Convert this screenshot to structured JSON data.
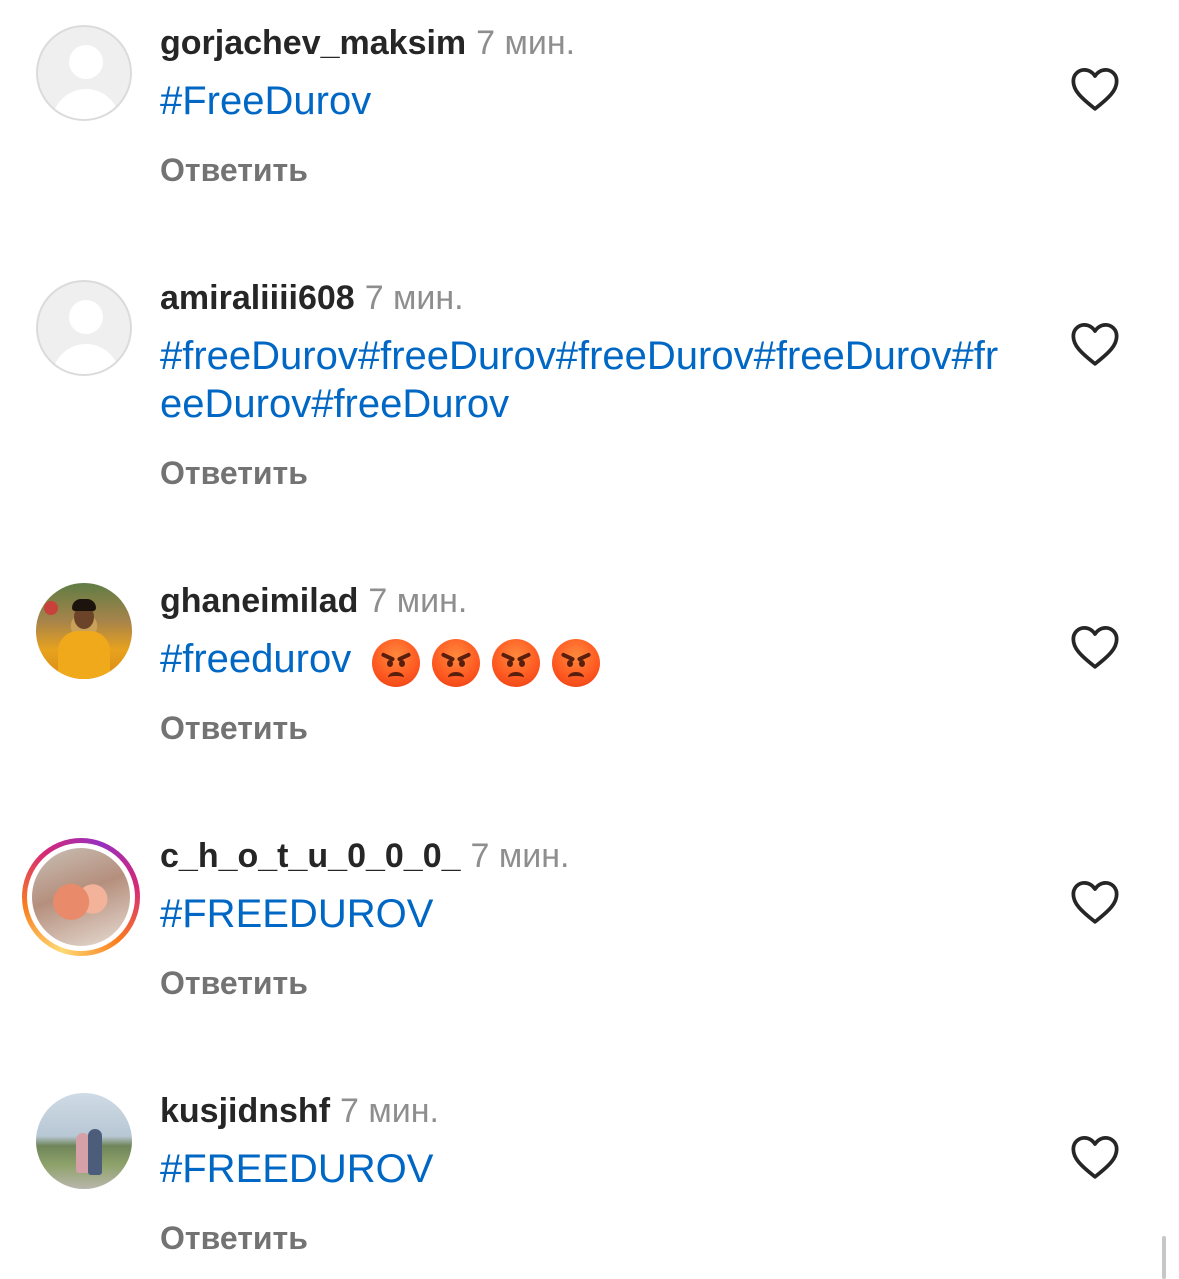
{
  "comments": [
    {
      "username": "gorjachev_maksim",
      "time": "7 мин.",
      "text": "#FreeDurov",
      "reply_label": "Ответить",
      "avatar": "default-avatar"
    },
    {
      "username": "amiraliiii608",
      "time": "7 мин.",
      "text": "#freeDurov#freeDurov#freeDurov#freeDurov#freeDurov#freeDurov",
      "reply_label": "Ответить",
      "avatar": "default-avatar"
    },
    {
      "username": "ghaneimilad",
      "time": "7 мин.",
      "text": "#freedurov",
      "emoji": [
        "angry-face",
        "angry-face",
        "angry-face",
        "angry-face"
      ],
      "reply_label": "Ответить",
      "avatar": "photo-avatar"
    },
    {
      "username": "c_h_o_t_u_0_0_0_",
      "time": "7 мин.",
      "text": "#FREEDUROV",
      "reply_label": "Ответить",
      "avatar": "story-ring-avatar"
    },
    {
      "username": "kusjidnshf",
      "time": "7 мин.",
      "text": "#FREEDUROV",
      "reply_label": "Ответить",
      "avatar": "photo-avatar"
    }
  ],
  "icons": {
    "like": "heart-outline-icon"
  },
  "colors": {
    "hashtag": "#0067c5",
    "username": "#262626",
    "secondary": "#8e8e8e",
    "reply": "#737373",
    "story_ring": [
      "#feda75",
      "#fa7e1e",
      "#d62976",
      "#962fbf"
    ]
  }
}
